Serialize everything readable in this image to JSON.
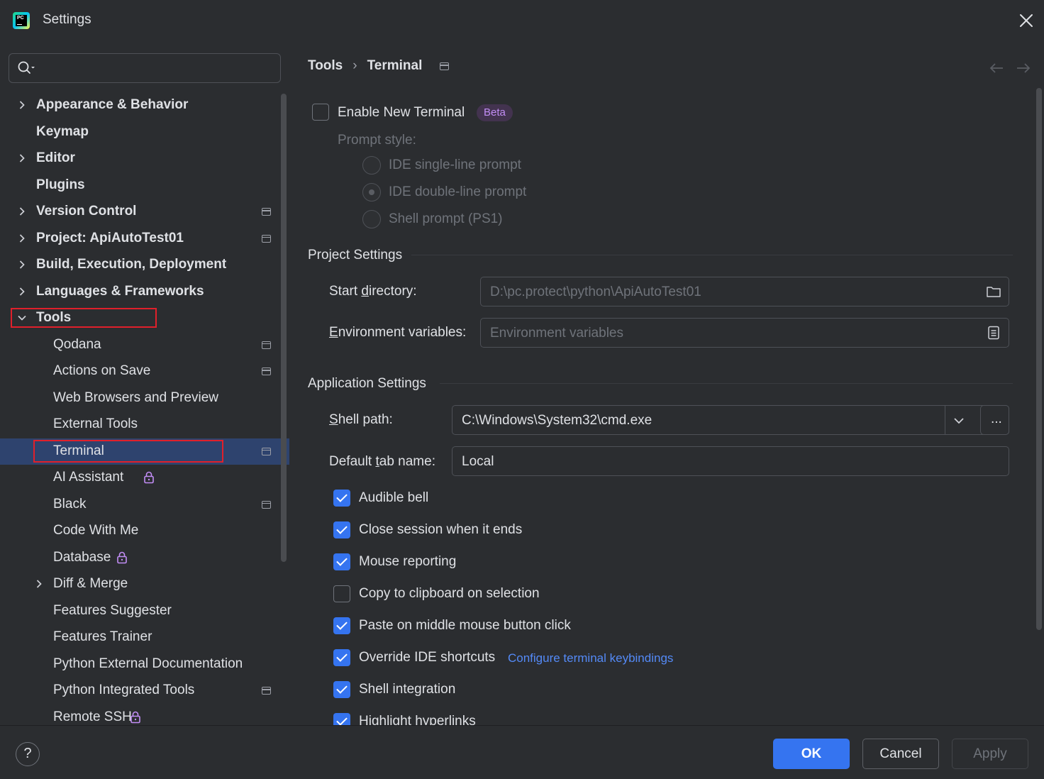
{
  "window": {
    "title": "Settings",
    "logo_text": "PC"
  },
  "search": {
    "placeholder": ""
  },
  "sidebar": {
    "items": [
      {
        "label": "Appearance & Behavior",
        "bold": true,
        "expandable": true,
        "expanded": false,
        "pinned": false,
        "locked": false
      },
      {
        "label": "Keymap",
        "bold": true,
        "expandable": false,
        "pinned": false,
        "locked": false
      },
      {
        "label": "Editor",
        "bold": true,
        "expandable": true,
        "expanded": false,
        "pinned": false,
        "locked": false
      },
      {
        "label": "Plugins",
        "bold": true,
        "expandable": false,
        "pinned": false,
        "locked": false
      },
      {
        "label": "Version Control",
        "bold": true,
        "expandable": true,
        "expanded": false,
        "pinned": true,
        "locked": false
      },
      {
        "label": "Project: ApiAutoTest01",
        "bold": true,
        "expandable": true,
        "expanded": false,
        "pinned": true,
        "locked": false
      },
      {
        "label": "Build, Execution, Deployment",
        "bold": true,
        "expandable": true,
        "expanded": false,
        "pinned": false,
        "locked": false
      },
      {
        "label": "Languages & Frameworks",
        "bold": true,
        "expandable": true,
        "expanded": false,
        "pinned": false,
        "locked": false
      },
      {
        "label": "Tools",
        "bold": true,
        "expandable": true,
        "expanded": true,
        "pinned": false,
        "locked": false
      },
      {
        "label": "Qodana",
        "bold": false,
        "child": true,
        "pinned": true,
        "locked": false
      },
      {
        "label": "Actions on Save",
        "bold": false,
        "child": true,
        "pinned": true,
        "locked": false
      },
      {
        "label": "Web Browsers and Preview",
        "bold": false,
        "child": true,
        "pinned": false,
        "locked": false
      },
      {
        "label": "External Tools",
        "bold": false,
        "child": true,
        "pinned": false,
        "locked": false
      },
      {
        "label": "Terminal",
        "bold": false,
        "child": true,
        "pinned": true,
        "locked": false,
        "selected": true
      },
      {
        "label": "AI Assistant",
        "bold": false,
        "child": true,
        "pinned": false,
        "locked": true
      },
      {
        "label": "Black",
        "bold": false,
        "child": true,
        "pinned": true,
        "locked": false
      },
      {
        "label": "Code With Me",
        "bold": false,
        "child": true,
        "pinned": false,
        "locked": false
      },
      {
        "label": "Database",
        "bold": false,
        "child": true,
        "pinned": false,
        "locked": true
      },
      {
        "label": "Diff & Merge",
        "bold": false,
        "child": true,
        "expandable": true,
        "pinned": false,
        "locked": false
      },
      {
        "label": "Features Suggester",
        "bold": false,
        "child": true,
        "pinned": false,
        "locked": false
      },
      {
        "label": "Features Trainer",
        "bold": false,
        "child": true,
        "pinned": false,
        "locked": false
      },
      {
        "label": "Python External Documentation",
        "bold": false,
        "child": true,
        "pinned": false,
        "locked": false
      },
      {
        "label": "Python Integrated Tools",
        "bold": false,
        "child": true,
        "pinned": true,
        "locked": false
      },
      {
        "label": "Remote SSH",
        "bold": false,
        "child": true,
        "pinned": false,
        "locked": true
      }
    ]
  },
  "breadcrumb": {
    "parent": "Tools",
    "separator": "›",
    "current": "Terminal"
  },
  "terminal": {
    "enable_new_terminal": {
      "label": "Enable New Terminal",
      "checked": false,
      "badge": "Beta"
    },
    "prompt_style": {
      "label": "Prompt style:",
      "options": [
        {
          "label": "IDE single-line prompt",
          "selected": false
        },
        {
          "label": "IDE double-line prompt",
          "selected": true
        },
        {
          "label": "Shell prompt (PS1)",
          "selected": false
        }
      ]
    },
    "project_settings": {
      "title": "Project Settings",
      "start_directory": {
        "label": "Start directory:",
        "mnemonic": "d",
        "value": "D:\\pc.protect\\python\\ApiAutoTest01"
      },
      "environment_variables": {
        "label": "Environment variables:",
        "mnemonic": "E",
        "placeholder": "Environment variables"
      }
    },
    "application_settings": {
      "title": "Application Settings",
      "shell_path": {
        "label": "Shell path:",
        "mnemonic": "S",
        "value": "C:\\Windows\\System32\\cmd.exe",
        "browse_label": "..."
      },
      "default_tab_name": {
        "label": "Default tab name:",
        "mnemonic": "t",
        "value": "Local"
      },
      "options": [
        {
          "label": "Audible bell",
          "checked": true
        },
        {
          "label": "Close session when it ends",
          "checked": true
        },
        {
          "label": "Mouse reporting",
          "checked": true
        },
        {
          "label": "Copy to clipboard on selection",
          "checked": false
        },
        {
          "label": "Paste on middle mouse button click",
          "checked": true
        },
        {
          "label": "Override IDE shortcuts",
          "checked": true,
          "link": "Configure terminal keybindings"
        },
        {
          "label": "Shell integration",
          "checked": true
        },
        {
          "label": "Highlight hyperlinks",
          "checked": true
        }
      ]
    }
  },
  "footer": {
    "help": "?",
    "ok": "OK",
    "cancel": "Cancel",
    "apply": "Apply"
  },
  "colors": {
    "accent": "#3574f0",
    "highlight": "#e0202b",
    "selection": "#2e436e",
    "link": "#548af7",
    "beta": "#c28df5"
  }
}
